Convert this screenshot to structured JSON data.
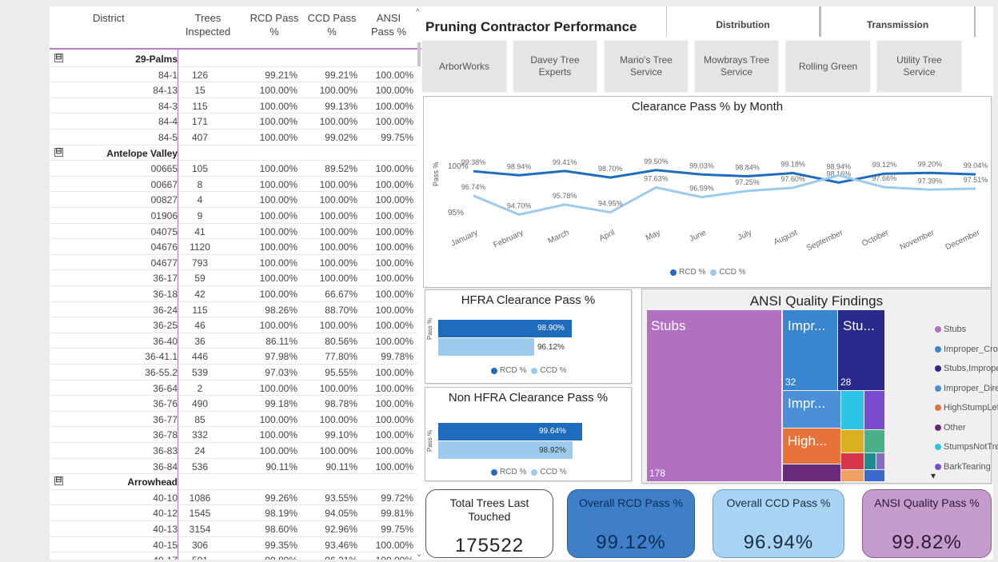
{
  "table": {
    "headers": {
      "district": "District",
      "trees": "Trees\nInspected",
      "rcd": "RCD Pass\n%",
      "ccd": "CCD Pass\n%",
      "ansi": "ANSI\nPass %"
    },
    "rows": [
      {
        "group": true,
        "name": "29-Palms",
        "expander": "⊟"
      },
      {
        "name": "84-1",
        "trees": "126",
        "rcd": "99.21%",
        "ccd": "99.21%",
        "ansi": "100.00%"
      },
      {
        "name": "84-13",
        "trees": "15",
        "rcd": "100.00%",
        "ccd": "100.00%",
        "ansi": "100.00%"
      },
      {
        "name": "84-3",
        "trees": "115",
        "rcd": "100.00%",
        "ccd": "99.13%",
        "ansi": "100.00%"
      },
      {
        "name": "84-4",
        "trees": "171",
        "rcd": "100.00%",
        "ccd": "100.00%",
        "ansi": "100.00%"
      },
      {
        "name": "84-5",
        "trees": "407",
        "rcd": "100.00%",
        "ccd": "99.02%",
        "ansi": "99.75%"
      },
      {
        "group": true,
        "name": "Antelope Valley",
        "expander": "⊟"
      },
      {
        "name": "00665",
        "trees": "105",
        "rcd": "100.00%",
        "ccd": "89.52%",
        "ansi": "100.00%"
      },
      {
        "name": "00667",
        "trees": "8",
        "rcd": "100.00%",
        "ccd": "100.00%",
        "ansi": "100.00%"
      },
      {
        "name": "00827",
        "trees": "4",
        "rcd": "100.00%",
        "ccd": "100.00%",
        "ansi": "100.00%"
      },
      {
        "name": "01906",
        "trees": "9",
        "rcd": "100.00%",
        "ccd": "100.00%",
        "ansi": "100.00%"
      },
      {
        "name": "04075",
        "trees": "41",
        "rcd": "100.00%",
        "ccd": "100.00%",
        "ansi": "100.00%"
      },
      {
        "name": "04676",
        "trees": "1120",
        "rcd": "100.00%",
        "ccd": "100.00%",
        "ansi": "100.00%"
      },
      {
        "name": "04677",
        "trees": "793",
        "rcd": "100.00%",
        "ccd": "100.00%",
        "ansi": "100.00%"
      },
      {
        "name": "36-17",
        "trees": "59",
        "rcd": "100.00%",
        "ccd": "100.00%",
        "ansi": "100.00%"
      },
      {
        "name": "36-18",
        "trees": "42",
        "rcd": "100.00%",
        "ccd": "66.67%",
        "ansi": "100.00%"
      },
      {
        "name": "36-24",
        "trees": "115",
        "rcd": "98.26%",
        "ccd": "88.70%",
        "ansi": "100.00%"
      },
      {
        "name": "36-25",
        "trees": "46",
        "rcd": "100.00%",
        "ccd": "100.00%",
        "ansi": "100.00%"
      },
      {
        "name": "36-40",
        "trees": "36",
        "rcd": "86.11%",
        "ccd": "80.56%",
        "ansi": "100.00%"
      },
      {
        "name": "36-41.1",
        "trees": "446",
        "rcd": "97.98%",
        "ccd": "77.80%",
        "ansi": "99.78%"
      },
      {
        "name": "36-55.2",
        "trees": "539",
        "rcd": "97.03%",
        "ccd": "95.55%",
        "ansi": "100.00%"
      },
      {
        "name": "36-64",
        "trees": "2",
        "rcd": "100.00%",
        "ccd": "100.00%",
        "ansi": "100.00%"
      },
      {
        "name": "36-76",
        "trees": "490",
        "rcd": "99.18%",
        "ccd": "98.78%",
        "ansi": "100.00%"
      },
      {
        "name": "36-77",
        "trees": "85",
        "rcd": "100.00%",
        "ccd": "100.00%",
        "ansi": "100.00%"
      },
      {
        "name": "36-78",
        "trees": "332",
        "rcd": "100.00%",
        "ccd": "99.10%",
        "ansi": "100.00%"
      },
      {
        "name": "36-83",
        "trees": "24",
        "rcd": "100.00%",
        "ccd": "100.00%",
        "ansi": "100.00%"
      },
      {
        "name": "36-84",
        "trees": "536",
        "rcd": "90.11%",
        "ccd": "90.11%",
        "ansi": "100.00%"
      },
      {
        "group": true,
        "name": "Arrowhead",
        "expander": "⊟"
      },
      {
        "name": "40-10",
        "trees": "1086",
        "rcd": "99.26%",
        "ccd": "93.55%",
        "ansi": "99.72%"
      },
      {
        "name": "40-12",
        "trees": "1545",
        "rcd": "98.19%",
        "ccd": "94.05%",
        "ansi": "99.81%"
      },
      {
        "name": "40-13",
        "trees": "3154",
        "rcd": "98.60%",
        "ccd": "92.96%",
        "ansi": "99.75%"
      },
      {
        "name": "40-15",
        "trees": "306",
        "rcd": "99.35%",
        "ccd": "93.46%",
        "ansi": "100.00%"
      },
      {
        "name": "40-17",
        "trees": "501",
        "rcd": "99.80%",
        "ccd": "96.21%",
        "ansi": "100.00%"
      }
    ],
    "scroll_up": "^",
    "scroll_down": "⌄"
  },
  "header": {
    "title": "Pruning Contractor Performance",
    "tabs": [
      "Distribution",
      "Transmission"
    ]
  },
  "slicer": [
    "ArborWorks",
    "Davey Tree Experts",
    "Mario's Tree Service",
    "Mowbrays Tree Service",
    "Rolling Green",
    "Utility Tree Service"
  ],
  "colors": {
    "rcd": "#1f6cbf",
    "ccd": "#9ccbee",
    "purple": "#b170c1",
    "navy": "#2a2a8c"
  },
  "line_chart": {
    "title": "Clearance Pass % by Month",
    "ylabel": "Pass %",
    "y_ticks": [
      "100%",
      "95%"
    ],
    "legend": [
      "RCD %",
      "CCD %"
    ]
  },
  "hfra": {
    "title": "HFRA Clearance Pass %",
    "ylabel": "Pass %",
    "rcd_label": "98.90%",
    "ccd_label": "96.12%",
    "rcd": 98.9,
    "ccd": 96.12,
    "legend": [
      "RCD %",
      "CCD %"
    ]
  },
  "nonhfra": {
    "title": "Non HFRA Clearance Pass %",
    "ylabel": "Pass %",
    "rcd_label": "99.64%",
    "ccd_label": "98.92%",
    "rcd": 99.64,
    "ccd": 98.92,
    "legend": [
      "RCD %",
      "CCD %"
    ]
  },
  "treemap": {
    "title": "ANSI Quality Findings",
    "tiles": [
      {
        "label": "Stubs",
        "value": "178"
      },
      {
        "label": "Impr...",
        "value": "32"
      },
      {
        "label": "Stu...",
        "value": "28"
      },
      {
        "label": "Impr...",
        "value": ""
      },
      {
        "label": "High...",
        "value": ""
      }
    ],
    "legend": [
      {
        "name": "Stubs",
        "color": "#b170c1"
      },
      {
        "name": "Improper_Crown...",
        "color": "#3a85cf"
      },
      {
        "name": "Stubs,Improper_...",
        "color": "#2a2a8c"
      },
      {
        "name": "Improper_Directi...",
        "color": "#4a8fd8"
      },
      {
        "name": "HighStumpLeftO...",
        "color": "#e8733a"
      },
      {
        "name": "Other",
        "color": "#6a2a7a"
      },
      {
        "name": "StumpsNotTreat...",
        "color": "#2ec4e8"
      },
      {
        "name": "BarkTearing",
        "color": "#7a4ad0"
      }
    ],
    "more": "▾"
  },
  "kpis": [
    {
      "label": "Total Trees Last\nTouched",
      "value": "175522"
    },
    {
      "label": "Overall RCD Pass %",
      "value": "99.12%"
    },
    {
      "label": "Overall CCD Pass %",
      "value": "96.94%"
    },
    {
      "label": "ANSI Quality Pass %",
      "value": "99.82%"
    }
  ],
  "chart_data": {
    "type": "line",
    "title": "Clearance Pass % by Month",
    "xlabel": "",
    "ylabel": "Pass %",
    "categories": [
      "January",
      "February",
      "March",
      "April",
      "May",
      "June",
      "July",
      "August",
      "September",
      "October",
      "November",
      "December"
    ],
    "series": [
      {
        "name": "RCD %",
        "values": [
          99.38,
          98.94,
          99.41,
          98.7,
          99.5,
          99.03,
          98.84,
          99.18,
          98.16,
          99.12,
          99.2,
          99.04
        ],
        "labels": [
          "99.38%",
          "98.94%",
          "99.41%",
          "98.70%",
          "99.50%",
          "99.03%",
          "98.84%",
          "99.18%",
          "98.16%",
          "99.12%",
          "99.20%",
          "99.04%"
        ]
      },
      {
        "name": "CCD %",
        "values": [
          96.74,
          94.7,
          95.78,
          94.95,
          97.63,
          96.59,
          97.25,
          97.6,
          98.94,
          97.66,
          97.39,
          97.51
        ],
        "labels": [
          "96.74%",
          "94.70%",
          "95.78%",
          "94.95%",
          "97.63%",
          "96.59%",
          "97.25%",
          "97.60%",
          "98.94%",
          "97.66%",
          "97.39%",
          "97.51%"
        ]
      }
    ],
    "ylim": [
      93,
      101
    ],
    "grid": false,
    "legend": "bottom"
  }
}
